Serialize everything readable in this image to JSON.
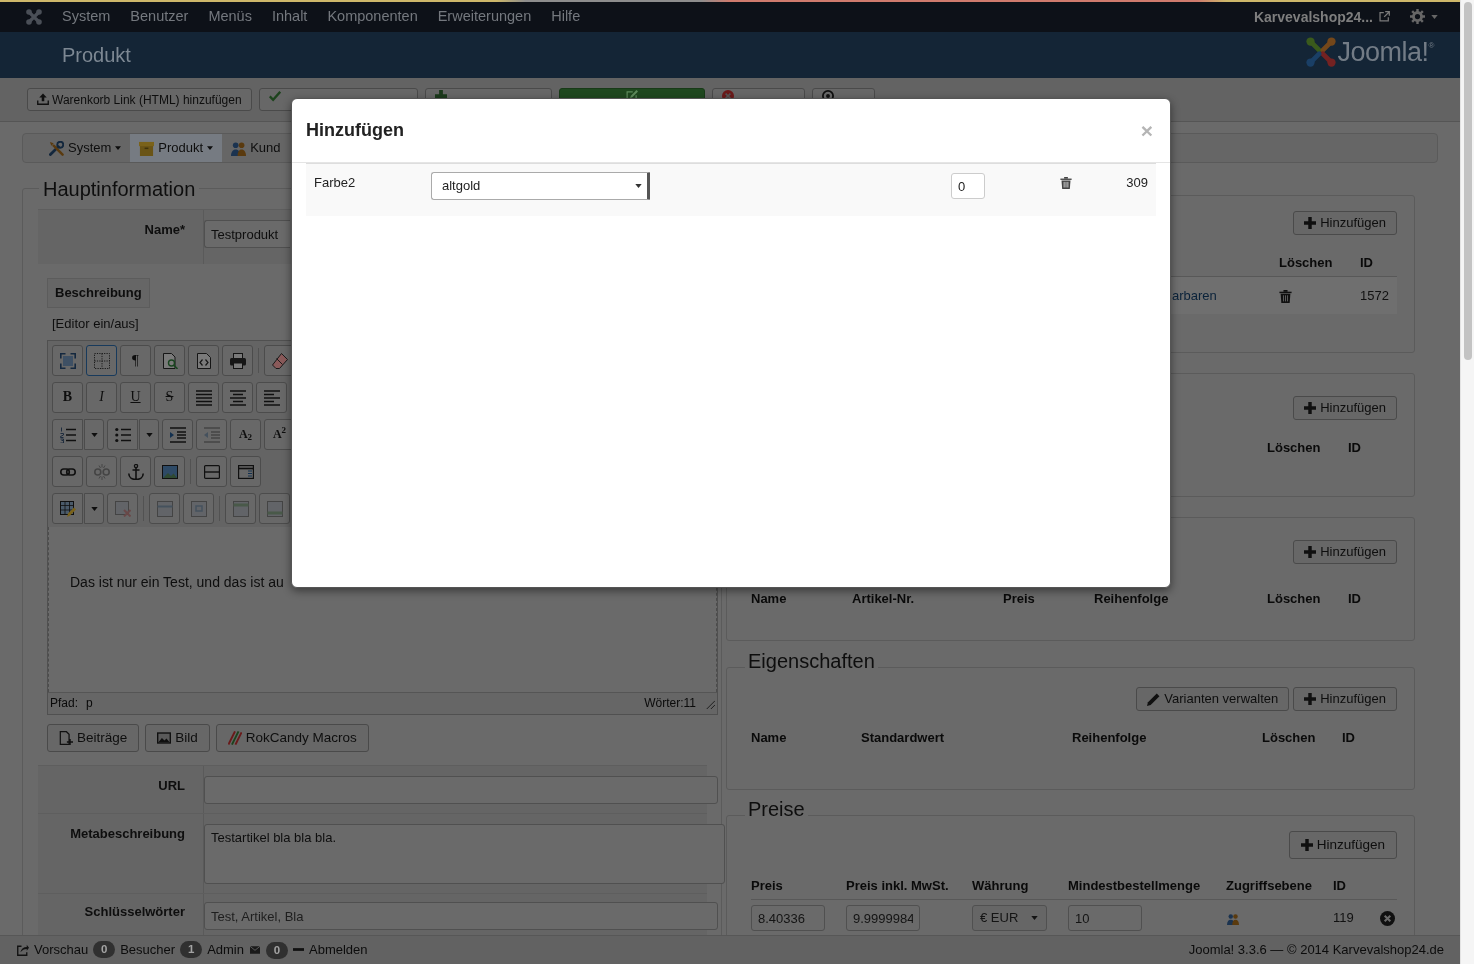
{
  "top_bar": {
    "menu": [
      "System",
      "Benutzer",
      "Menüs",
      "Inhalt",
      "Komponenten",
      "Erweiterungen",
      "Hilfe"
    ],
    "site_link": "Karvevalshop24..."
  },
  "header": {
    "title": "Produkt",
    "logo_text": "Joomla!$^{®}$"
  },
  "toolbar": {
    "buttons": [
      {
        "kind": "upload",
        "label": "Warenkorb Link (HTML) hinzufügen"
      },
      {
        "kind": "check"
      },
      {
        "kind": "plus"
      },
      {
        "kind": "edit"
      },
      {
        "kind": "cancel"
      },
      {
        "kind": "help"
      }
    ]
  },
  "subnav": {
    "items": [
      {
        "kind": "tools",
        "label": "System",
        "dropdown": true,
        "selected": false
      },
      {
        "kind": "box",
        "label": "Produkt",
        "dropdown": true,
        "selected": true
      },
      {
        "kind": "users",
        "label": "Kund",
        "dropdown": false,
        "selected": false
      }
    ]
  },
  "main_info": {
    "legend": "Hauptinformation",
    "name_label": "Name*",
    "name_value": "Testprodukt",
    "description_tab": "Beschreibung",
    "editor_toggle": "[Editor ein/aus]",
    "editor": {
      "toolbar": [
        [
          [
            {
              "kind": "fullscreen",
              "menu": false,
              "active": false,
              "disabled": false
            },
            {
              "kind": "visualaid",
              "menu": false,
              "active": true,
              "disabled": false
            },
            {
              "kind": "paragraph",
              "label": "¶",
              "menu": false,
              "active": false,
              "disabled": false
            },
            {
              "kind": "preview",
              "menu": false,
              "active": false,
              "disabled": false
            },
            {
              "kind": "code",
              "menu": false,
              "active": false,
              "disabled": false
            },
            {
              "kind": "print",
              "menu": false,
              "active": false,
              "disabled": false
            }
          ],
          [
            {
              "kind": "eraser",
              "menu": false,
              "active": false,
              "disabled": false
            }
          ]
        ],
        [
          [
            {
              "kind": "bold",
              "label": "B",
              "menu": false,
              "active": false,
              "disabled": false
            },
            {
              "kind": "italic",
              "label": "I",
              "menu": false,
              "active": false,
              "disabled": false
            },
            {
              "kind": "underline",
              "label": "U",
              "menu": false,
              "active": false,
              "disabled": false
            },
            {
              "kind": "strike",
              "label": "S",
              "menu": false,
              "active": false,
              "disabled": false
            },
            {
              "kind": "justify",
              "menu": false,
              "active": false,
              "disabled": false
            },
            {
              "kind": "center",
              "menu": false,
              "active": false,
              "disabled": false
            },
            {
              "kind": "left",
              "menu": false,
              "active": false,
              "disabled": false
            }
          ]
        ],
        [
          [
            {
              "kind": "ordered_list",
              "menu": true,
              "active": false,
              "disabled": false
            },
            {
              "kind": "bullet_list",
              "menu": true,
              "active": false,
              "disabled": false
            },
            {
              "kind": "indent",
              "menu": false,
              "active": false,
              "disabled": false
            },
            {
              "kind": "outdent",
              "menu": false,
              "active": false,
              "disabled": true
            },
            {
              "kind": "subscript",
              "label": "A$_{2}$",
              "menu": false,
              "active": false,
              "disabled": false
            },
            {
              "kind": "superscript",
              "label": "A$^{2}$",
              "menu": false,
              "active": false,
              "disabled": false
            }
          ]
        ],
        [
          [
            {
              "kind": "link",
              "menu": false,
              "active": false,
              "disabled": false
            },
            {
              "kind": "unlink",
              "menu": false,
              "active": false,
              "disabled": true
            },
            {
              "kind": "anchor",
              "menu": false,
              "active": false,
              "disabled": false
            },
            {
              "kind": "image",
              "menu": false,
              "active": false,
              "disabled": false
            }
          ],
          [
            {
              "kind": "rule",
              "menu": false,
              "active": false,
              "disabled": false
            },
            {
              "kind": "template",
              "menu": false,
              "active": false,
              "disabled": false
            }
          ]
        ],
        [
          [
            {
              "kind": "table",
              "menu": true,
              "active": false,
              "disabled": false
            },
            {
              "kind": "delete_table",
              "menu": false,
              "active": false,
              "disabled": true
            }
          ],
          [
            {
              "kind": "row_props",
              "menu": false,
              "active": false,
              "disabled": true
            },
            {
              "kind": "cell_props",
              "menu": false,
              "active": false,
              "disabled": true
            }
          ],
          [
            {
              "kind": "row_before",
              "menu": false,
              "active": false,
              "disabled": true
            },
            {
              "kind": "row_after",
              "menu": false,
              "active": false,
              "disabled": true
            }
          ]
        ]
      ],
      "content": "Das ist nur ein Test, und das ist au",
      "path_label": "Pfad:",
      "path": "p",
      "word_count": "Wörter:11"
    },
    "editor_buttons": [
      {
        "kind": "article",
        "label": "Beiträge"
      },
      {
        "kind": "image",
        "label": "Bild"
      },
      {
        "kind": "rokcandy",
        "label": "RokCandy Macros"
      }
    ],
    "fields": [
      {
        "kind": "input",
        "label": "URL"
      },
      {
        "kind": "textarea",
        "label": "Metabeschreibung",
        "value": "Testartikel bla bla bla."
      },
      {
        "kind": "input",
        "label": "Schlüsselwörter",
        "placeholder": "Test, Artikel, Bla"
      }
    ]
  },
  "sections": [
    {
      "buttons": [
        {
          "kind": "add",
          "label": "Hinzufügen"
        }
      ],
      "columns": [
        "Löschen",
        "ID"
      ],
      "rows": [
        {
          "cells": [
            {
              "kind": "link",
              "text": "arbaren"
            },
            {
              "kind": "trash"
            },
            {
              "kind": "text",
              "text": "1572"
            }
          ]
        }
      ]
    },
    {
      "buttons": [
        {
          "kind": "add",
          "label": "Hinzufügen"
        }
      ],
      "columns": [
        "Löschen",
        "ID"
      ]
    },
    {
      "buttons": [
        {
          "kind": "add",
          "label": "Hinzufügen"
        }
      ],
      "columns": [
        "Name",
        "Artikel-Nr.",
        "Preis",
        "Reihenfolge",
        "Löschen",
        "ID"
      ]
    },
    {
      "legend": "Eigenschaften",
      "buttons": [
        {
          "kind": "edit",
          "label": "Varianten verwalten"
        },
        {
          "kind": "add",
          "label": "Hinzufügen"
        }
      ],
      "columns": [
        "Name",
        "Standardwert",
        "Reihenfolge",
        "Löschen",
        "ID"
      ]
    },
    {
      "legend": "Preise",
      "buttons": [
        {
          "kind": "add",
          "label": "Hinzufügen"
        }
      ],
      "columns": [
        "Preis",
        "Preis inkl. MwSt.",
        "Währung",
        "Mindestbestellmenge",
        "Zugriffsebene",
        "ID"
      ],
      "rows": [
        {
          "cells": [
            {
              "kind": "input",
              "text": "8.40336"
            },
            {
              "kind": "input",
              "text": "9.9999984"
            },
            {
              "kind": "select",
              "text": "€ EUR"
            },
            {
              "kind": "input",
              "text": "10"
            },
            {
              "kind": "users"
            },
            {
              "kind": "text",
              "text": "119"
            },
            {
              "kind": "remove"
            }
          ]
        }
      ]
    }
  ],
  "footer": {
    "items": [
      {
        "kind": "preview",
        "label": "Vorschau"
      },
      {
        "kind": "count",
        "count": "0",
        "label": "Besucher"
      },
      {
        "kind": "count",
        "count": "1",
        "label": "Admin"
      },
      {
        "kind": "mail",
        "count": "0"
      },
      {
        "kind": "logout",
        "label": "Abmelden"
      }
    ],
    "credits": "Joomla! 3.3.6 — © 2014 Karvevalshop24.de"
  },
  "modal": {
    "title": "Hinzufügen",
    "close": "×",
    "rows": [
      {
        "name": "Farbe2",
        "value": "altgold",
        "quantity": "0",
        "id": "309"
      }
    ]
  }
}
